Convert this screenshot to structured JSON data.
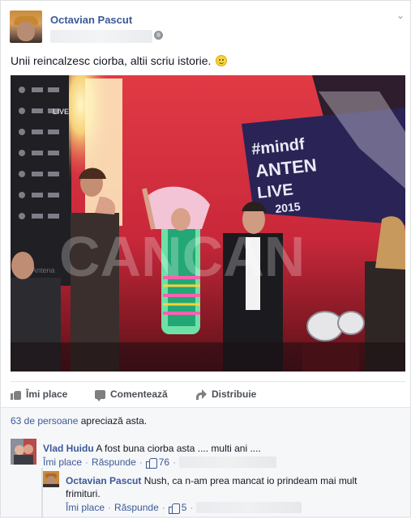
{
  "post": {
    "author": "Octavian Pascut",
    "status_text": "Unii reincalzesc ciorba, altii scriu istorie.",
    "emoji_icon": "smile-icon",
    "privacy_icon": "globe-icon",
    "menu_icon": "chevron-down-icon"
  },
  "photo": {
    "banner_lines": [
      "#mindf",
      "ANTEN",
      "LIVE",
      "2015"
    ],
    "brand_text": "Antena",
    "backdrop_logo": "LIVE",
    "watermark": "CANCAN"
  },
  "actions": {
    "like": "Îmi place",
    "comment": "Comentează",
    "share": "Distribuie"
  },
  "likes_summary": {
    "count_link": "63 de persoane",
    "suffix": " apreciază asta."
  },
  "comments": [
    {
      "author": "Vlad Huidu",
      "text": " A fost buna ciorba asta .... multi ani ....",
      "like_label": "Îmi place",
      "reply_label": "Răspunde",
      "likes": "76"
    },
    {
      "author": "Octavian Pascut",
      "text": " Nush, ca n-am prea mancat io prindeam mai mult frimituri.",
      "like_label": "Îmi place",
      "reply_label": "Răspunde",
      "likes": "5"
    }
  ],
  "separator": "·",
  "colors": {
    "link": "#3b5998",
    "stage_red": "#d8313c",
    "panel_bg": "#f6f7f9"
  }
}
